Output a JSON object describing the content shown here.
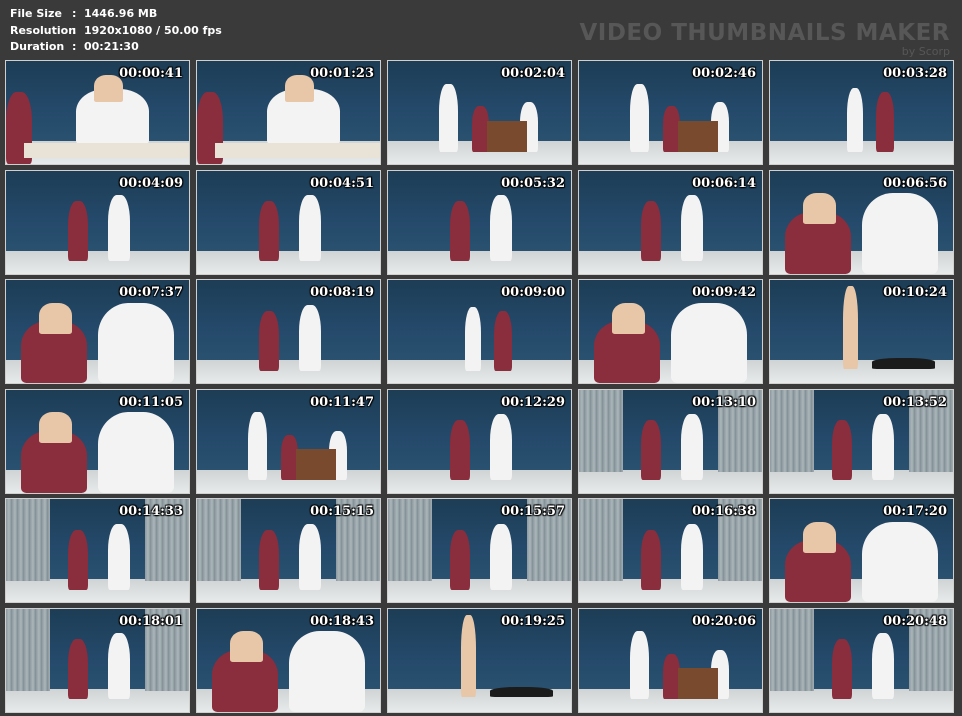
{
  "header": {
    "file_size_label": "File Size",
    "file_size_value": "1446.96 MB",
    "resolution_label": "Resolution",
    "resolution_value": "1920x1080 / 50.00 fps",
    "duration_label": "Duration",
    "duration_value": "00:21:30",
    "separator": ":",
    "watermark": "VIDEO THUMBNAILS MAKER",
    "watermark_sub": "by Scorp"
  },
  "thumbnails": [
    {
      "time": "00:00:41",
      "scene": "closeup-desk"
    },
    {
      "time": "00:01:23",
      "scene": "closeup-desk"
    },
    {
      "time": "00:02:04",
      "scene": "room-desk"
    },
    {
      "time": "00:02:46",
      "scene": "room-desk"
    },
    {
      "time": "00:03:28",
      "scene": "room-wide"
    },
    {
      "time": "00:04:09",
      "scene": "wall-two"
    },
    {
      "time": "00:04:51",
      "scene": "wall-two"
    },
    {
      "time": "00:05:32",
      "scene": "wall-two"
    },
    {
      "time": "00:06:14",
      "scene": "wall-two"
    },
    {
      "time": "00:06:56",
      "scene": "closeup"
    },
    {
      "time": "00:07:37",
      "scene": "closeup"
    },
    {
      "time": "00:08:19",
      "scene": "wall-two"
    },
    {
      "time": "00:09:00",
      "scene": "room-wide"
    },
    {
      "time": "00:09:42",
      "scene": "closeup"
    },
    {
      "time": "00:10:24",
      "scene": "room-floor"
    },
    {
      "time": "00:11:05",
      "scene": "closeup"
    },
    {
      "time": "00:11:47",
      "scene": "room-desk"
    },
    {
      "time": "00:12:29",
      "scene": "wall-two"
    },
    {
      "time": "00:13:10",
      "scene": "curtain-two"
    },
    {
      "time": "00:13:52",
      "scene": "curtain-two"
    },
    {
      "time": "00:14:33",
      "scene": "curtain-two"
    },
    {
      "time": "00:15:15",
      "scene": "curtain-two"
    },
    {
      "time": "00:15:57",
      "scene": "curtain-two"
    },
    {
      "time": "00:16:38",
      "scene": "curtain-two"
    },
    {
      "time": "00:17:20",
      "scene": "closeup"
    },
    {
      "time": "00:18:01",
      "scene": "curtain-one"
    },
    {
      "time": "00:18:43",
      "scene": "closeup"
    },
    {
      "time": "00:19:25",
      "scene": "room-floor"
    },
    {
      "time": "00:20:06",
      "scene": "room-desk"
    },
    {
      "time": "00:20:48",
      "scene": "curtain-two"
    }
  ]
}
